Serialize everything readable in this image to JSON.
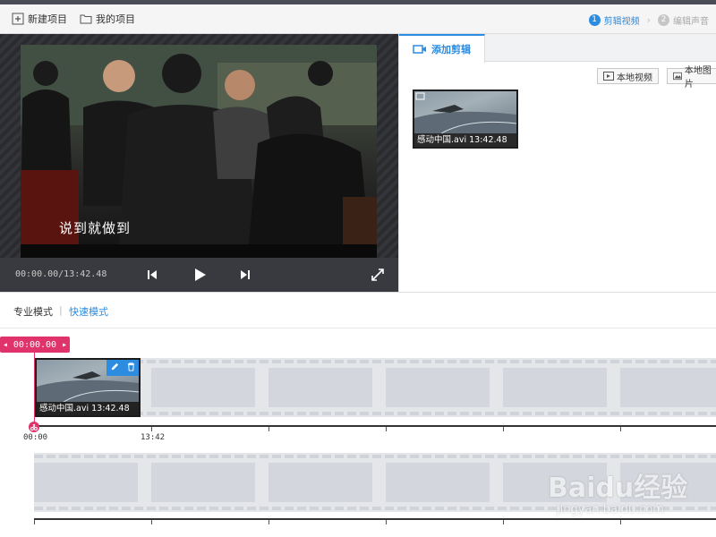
{
  "toolbar": {
    "new_project": "新建项目",
    "my_project": "我的项目"
  },
  "steps": [
    {
      "num": "1",
      "label": "剪辑视频",
      "state": "active"
    },
    {
      "num": "2",
      "label": "编辑声音",
      "state": "inactive"
    }
  ],
  "player": {
    "subtitle": "说到就做到",
    "timecode": "00:00.00/13:42.48"
  },
  "panel": {
    "tab_label": "添加剪辑",
    "local_video": "本地视频",
    "local_image": "本地图片",
    "clip_caption": "感动中国.avi 13:42.48"
  },
  "modes": {
    "pro": "专业模式",
    "divider": "|",
    "quick": "快速模式"
  },
  "timeline": {
    "playhead_time": "00:00.00",
    "clip_caption": "感动中国.avi 13:42.48",
    "ruler_labels": [
      "00:00",
      "13:42"
    ]
  },
  "watermark": {
    "brand": "Baidu经验",
    "url": "jingyan.baidu.com"
  },
  "colors": {
    "accent_blue": "#2b8ce0",
    "playhead_pink": "#e0336b",
    "topstrip": "#4a4d55"
  }
}
